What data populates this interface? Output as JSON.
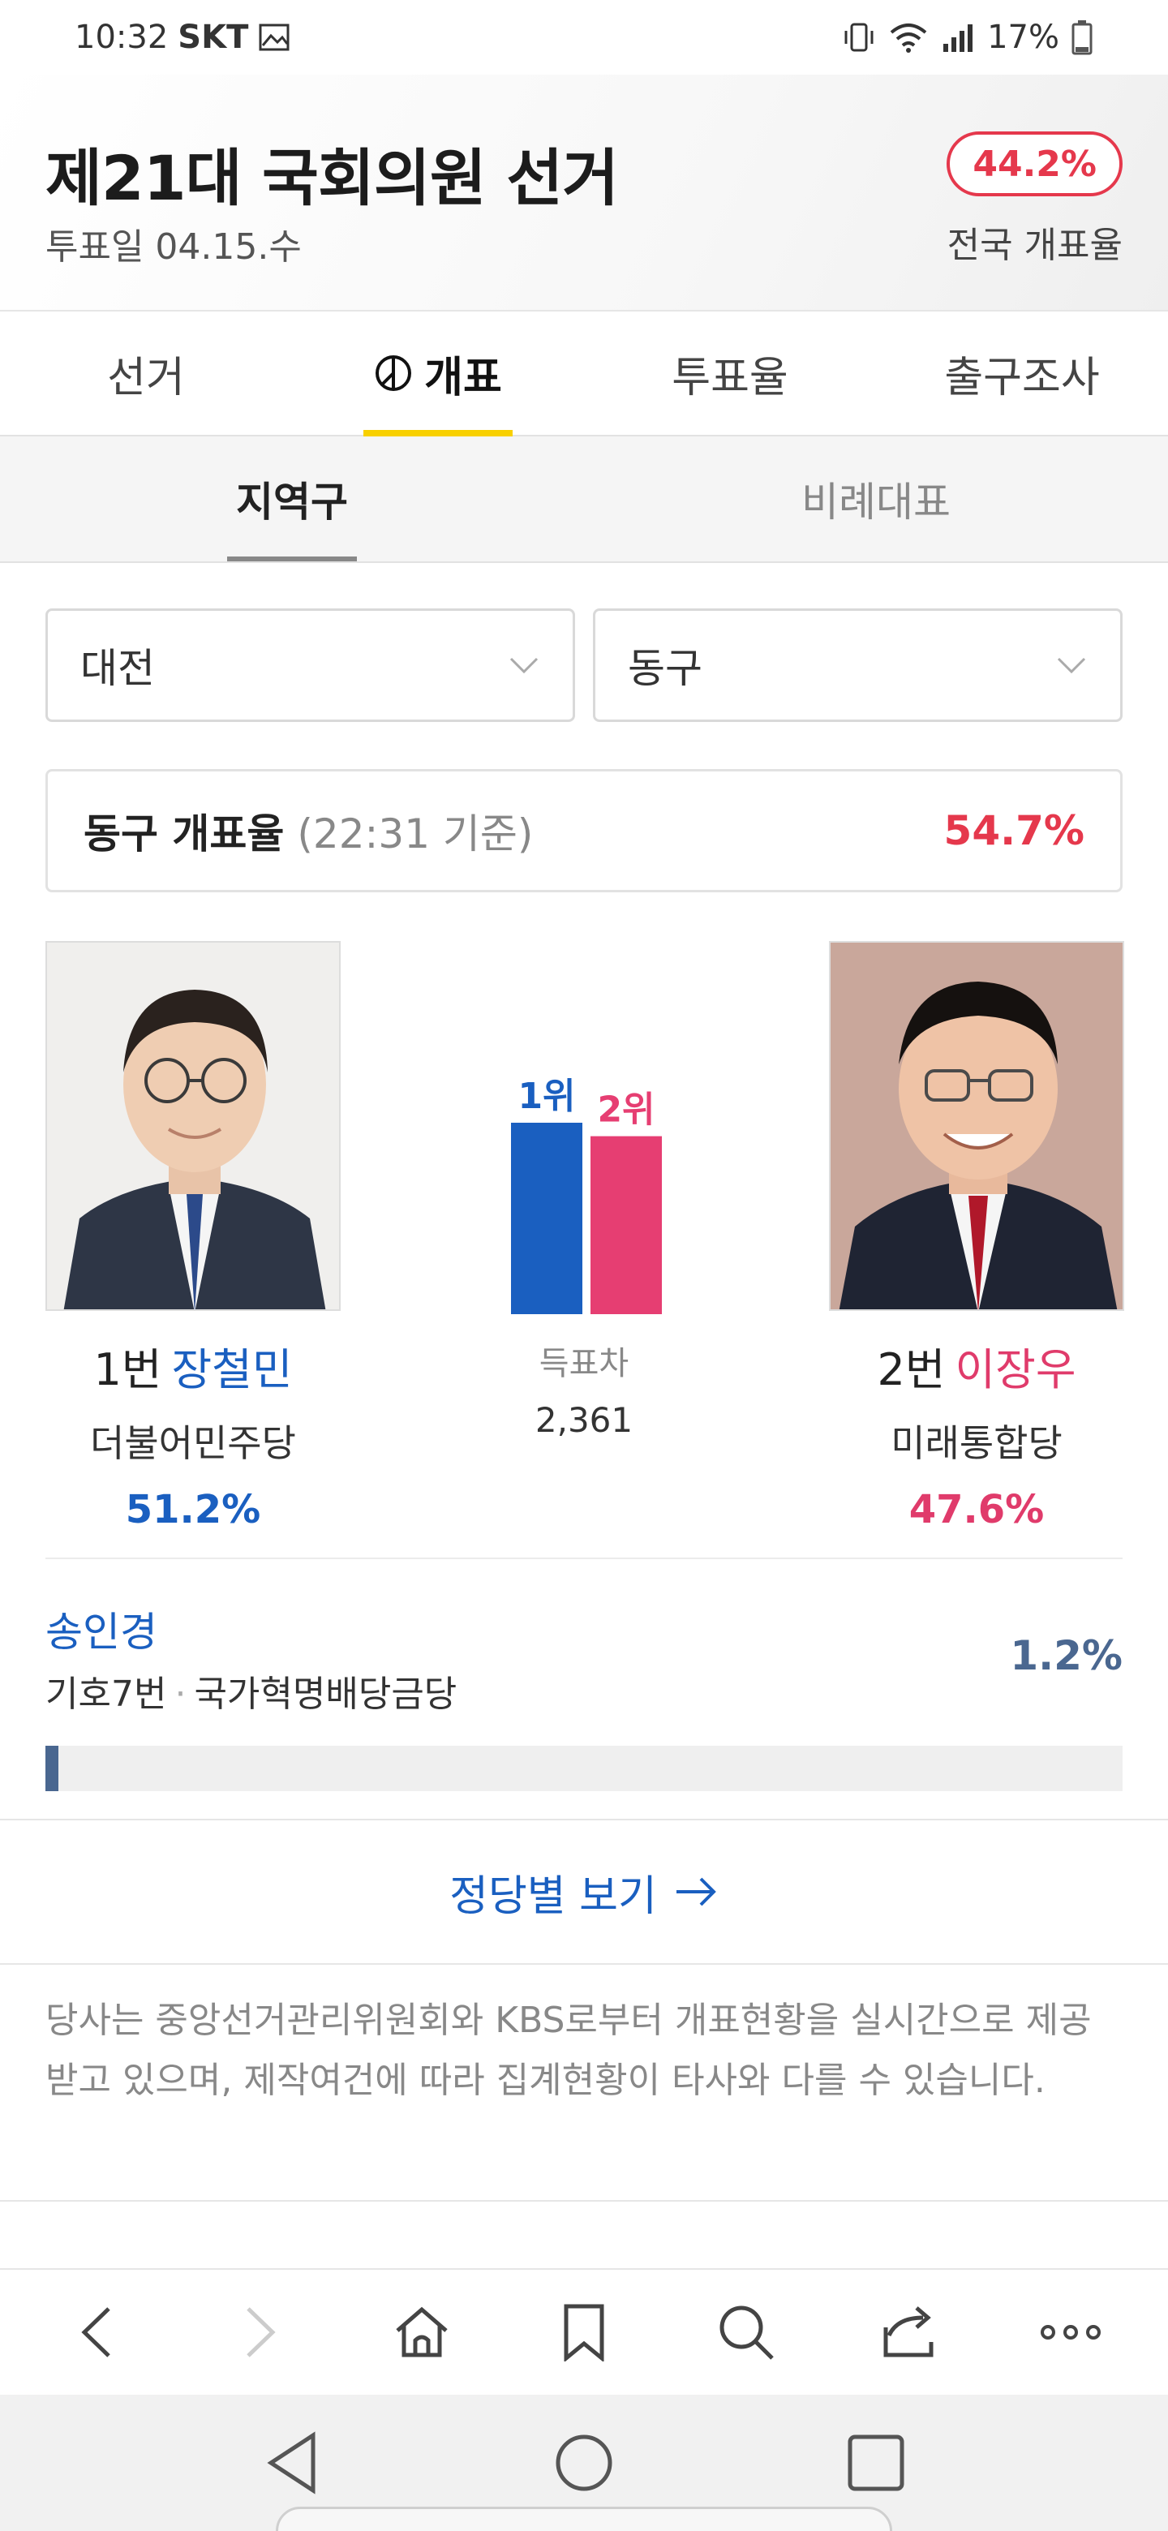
{
  "status_bar": {
    "time": "10:32",
    "carrier": "SKT",
    "battery": "17%"
  },
  "header": {
    "title": "제21대 국회의원 선거",
    "date": "투표일 04.15.수",
    "national_rate": "44.2%",
    "national_rate_label": "전국 개표율"
  },
  "main_tabs": [
    {
      "label": "선거"
    },
    {
      "label": "개표"
    },
    {
      "label": "투표율"
    },
    {
      "label": "출구조사"
    }
  ],
  "sub_tabs": [
    {
      "label": "지역구"
    },
    {
      "label": "비례대표"
    }
  ],
  "filters": {
    "region": "대전",
    "district": "동구"
  },
  "count_rate": {
    "label": "동구 개표율",
    "time": "(22:31 기준)",
    "value": "54.7%"
  },
  "candidates": [
    {
      "number": "1번",
      "name": "장철민",
      "party": "더불어민주당",
      "percent": "51.2%",
      "color": "#1a5fc0"
    },
    {
      "number": "2번",
      "name": "이장우",
      "party": "미래통합당",
      "percent": "47.6%",
      "color": "#e03b6b"
    }
  ],
  "chart_data": {
    "type": "bar",
    "categories": [
      "1위",
      "2위"
    ],
    "values": [
      51.2,
      47.6
    ],
    "colors": [
      "#1a5fc0",
      "#e63e72"
    ]
  },
  "vote_gap": {
    "label": "득표차",
    "value": "2,361"
  },
  "minor_candidate": {
    "name": "송인경",
    "number": "기호7번",
    "party": "국가혁명배당금당",
    "percent": "1.2%",
    "fill_fraction": 0.012
  },
  "party_view_link": "정당별 보기",
  "notice": "당사는 중앙선거관리위원회와 KBS로부터 개표현황을 실시간으로 제공받고 있으며, 제작여건에 따라 집계현황이 타사와 다를 수 있습니다.",
  "icons": {
    "browser": [
      "back-icon",
      "forward-icon",
      "home-icon",
      "bookmark-icon",
      "search-icon",
      "share-icon",
      "more-icon"
    ],
    "nav": [
      "nav-back-icon",
      "nav-home-icon",
      "nav-recent-icon"
    ]
  }
}
